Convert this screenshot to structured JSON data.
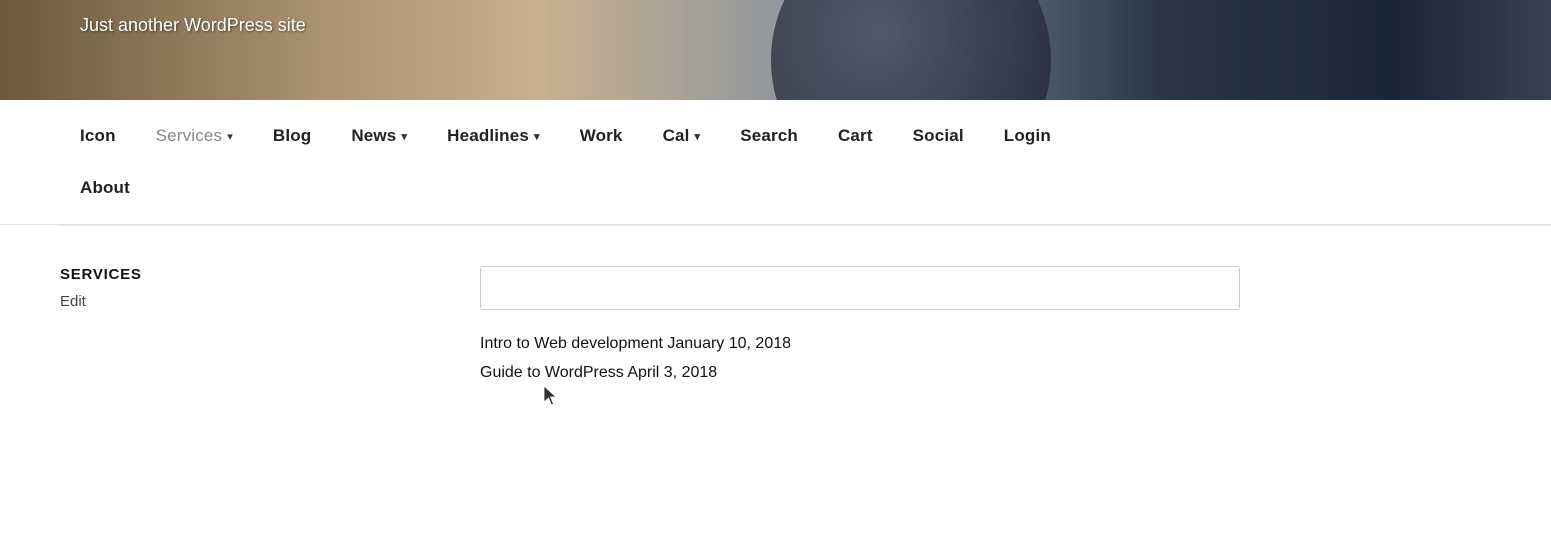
{
  "hero": {
    "subtitle": "Just another WordPress site"
  },
  "nav": {
    "row1": [
      {
        "id": "icon",
        "label": "Icon",
        "hasDropdown": false
      },
      {
        "id": "services",
        "label": "Services",
        "hasDropdown": true,
        "active": true
      },
      {
        "id": "blog",
        "label": "Blog",
        "hasDropdown": false
      },
      {
        "id": "news",
        "label": "News",
        "hasDropdown": true
      },
      {
        "id": "headlines",
        "label": "Headlines",
        "hasDropdown": true
      },
      {
        "id": "work",
        "label": "Work",
        "hasDropdown": false
      },
      {
        "id": "cal",
        "label": "Cal",
        "hasDropdown": true
      },
      {
        "id": "search",
        "label": "Search",
        "hasDropdown": false
      },
      {
        "id": "cart",
        "label": "Cart",
        "hasDropdown": false
      },
      {
        "id": "social",
        "label": "Social",
        "hasDropdown": false
      },
      {
        "id": "login",
        "label": "Login",
        "hasDropdown": false
      }
    ],
    "row2": [
      {
        "id": "about",
        "label": "About",
        "hasDropdown": false
      }
    ]
  },
  "main": {
    "services_section": {
      "title": "SERVICES",
      "edit_label": "Edit"
    },
    "search": {
      "placeholder": ""
    },
    "posts": [
      {
        "title": "Intro to Web development",
        "date": "January 10, 2018"
      },
      {
        "title": "Guide to WordPress",
        "date": "April 3, 2018"
      }
    ]
  }
}
